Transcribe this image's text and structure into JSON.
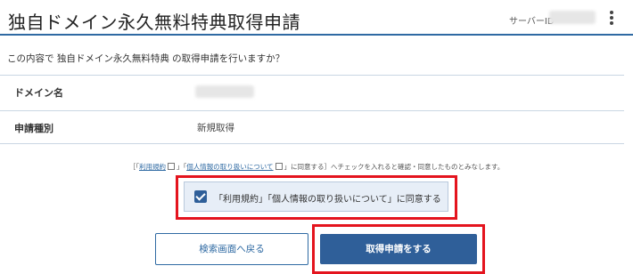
{
  "header": {
    "title": "独自ドメイン永久無料特典取得申請",
    "server_label": "サーバーID"
  },
  "question": "この内容で 独自ドメイン永久無料特典 の取得申請を行いますか？",
  "rows": [
    {
      "label": "ドメイン名",
      "value": ""
    },
    {
      "label": "申請種別",
      "value": "新規取得"
    }
  ],
  "notice": {
    "prefix": "［「",
    "terms_link": "利用規約",
    "mid1": "」「",
    "privacy_link": "個人情報の取り扱いについて",
    "suffix": "」に同意する］へチェックを入れると確認・同意したものとみなします。"
  },
  "agree": {
    "label": "「利用規約」「個人情報の取り扱いについて」に同意する",
    "checked": true
  },
  "buttons": {
    "back": "検索画面へ戻る",
    "submit": "取得申請をする"
  },
  "colors": {
    "accent": "#2f5f99",
    "highlight": "#e4141e"
  },
  "icons": [
    "kebab-menu-icon",
    "external-link-icon",
    "checkbox-checked-icon"
  ]
}
